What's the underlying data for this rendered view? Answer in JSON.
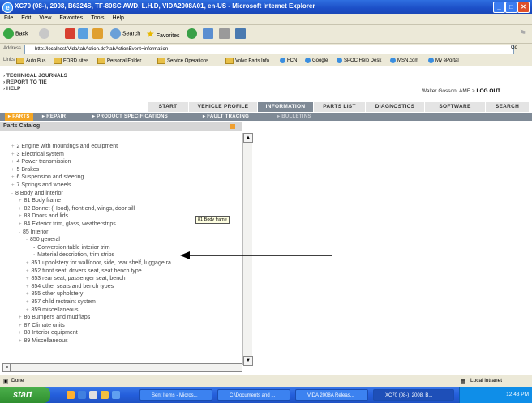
{
  "window": {
    "title": "XC70 (08-), 2008, B6324S, TF-80SC AWD, L.H.D, VIDA2008A01, en-US - Microsoft Internet Explorer"
  },
  "menu": [
    "File",
    "Edit",
    "View",
    "Favorites",
    "Tools",
    "Help"
  ],
  "toolbar": {
    "back": "Back",
    "search": "Search",
    "favorites": "Favorites"
  },
  "address": {
    "label": "Address",
    "url": "http://localhost/Vida/tabAction.do?tabActionEvent=information",
    "go": "Go"
  },
  "links": {
    "label": "Links",
    "items": [
      "Auto Bus",
      "FORD sites",
      "Personal Folder",
      "Service Operations",
      "Volvo Parts Info",
      "FCN",
      "Google",
      "SPOC Help Desk",
      "MSN.com",
      "My ePortal"
    ]
  },
  "top_links": [
    "TECHNICAL JOURNALS",
    "REPORT TO TIE",
    "HELP"
  ],
  "user": {
    "name": "Walter Gosson, AME",
    "separator": ">",
    "logout": "LOG OUT"
  },
  "tabs": [
    "START",
    "VEHICLE PROFILE",
    "INFORMATION",
    "PARTS LIST",
    "DIAGNOSTICS",
    "SOFTWARE",
    "SEARCH"
  ],
  "active_tab": "INFORMATION",
  "subtabs": [
    "PARTS",
    "REPAIR",
    "PRODUCT SPECIFICATIONS",
    "FAULT TRACING",
    "BULLETINS"
  ],
  "panel": {
    "title": "Parts Catalog"
  },
  "tree": [
    {
      "label": "2 Engine with mountings and equipment",
      "toggle": "+"
    },
    {
      "label": "3 Electrical system",
      "toggle": "+"
    },
    {
      "label": "4 Power transmission",
      "toggle": "+"
    },
    {
      "label": "5 Brakes",
      "toggle": "+"
    },
    {
      "label": "6 Suspension and steering",
      "toggle": "+"
    },
    {
      "label": "7 Springs and wheels",
      "toggle": "+"
    },
    {
      "label": "8 Body and interior",
      "toggle": "-"
    },
    {
      "label": "81 Body frame",
      "toggle": "+"
    },
    {
      "label": "82 Bonnet (Hood), front end, wings, door sill",
      "toggle": "+"
    },
    {
      "label": "83 Doors and lids",
      "toggle": "+"
    },
    {
      "label": "84 Exterior trim, glass, weatherstrips",
      "toggle": "+"
    },
    {
      "label": "85 Interior",
      "toggle": "-"
    },
    {
      "label": "850 general",
      "toggle": "-"
    },
    {
      "label": "Conversion table interior trim",
      "toggle": "▪"
    },
    {
      "label": "Material description, trim strips",
      "toggle": "▪"
    },
    {
      "label": "851 upholstery for wall/door, side, rear shelf, luggage ra",
      "toggle": "+"
    },
    {
      "label": "852 front seat, drivers seat, seat bench type",
      "toggle": "+"
    },
    {
      "label": "853 rear seat, passenger seat, bench",
      "toggle": "+"
    },
    {
      "label": "854 other seats and bench types",
      "toggle": "+"
    },
    {
      "label": "855 other upholstery",
      "toggle": "+"
    },
    {
      "label": "857 child restraint system",
      "toggle": "+"
    },
    {
      "label": "859 miscellaneous",
      "toggle": "+"
    },
    {
      "label": "86 Bumpers and mudflaps",
      "toggle": "+"
    },
    {
      "label": "87 Climate units",
      "toggle": "+"
    },
    {
      "label": "88 Interior equipment",
      "toggle": "+"
    },
    {
      "label": "89 Miscellaneous",
      "toggle": "+"
    }
  ],
  "tooltip": "81 Body frame",
  "status": {
    "text": "Done",
    "zone": "Local intranet"
  },
  "taskbar": {
    "start": "start",
    "tasks": [
      "Sent Items - Micros...",
      "C:\\Documents and ...",
      "VIDA 2008A Releas...",
      "XC70 (08-), 2008, B..."
    ],
    "clock": "12:43 PM"
  }
}
